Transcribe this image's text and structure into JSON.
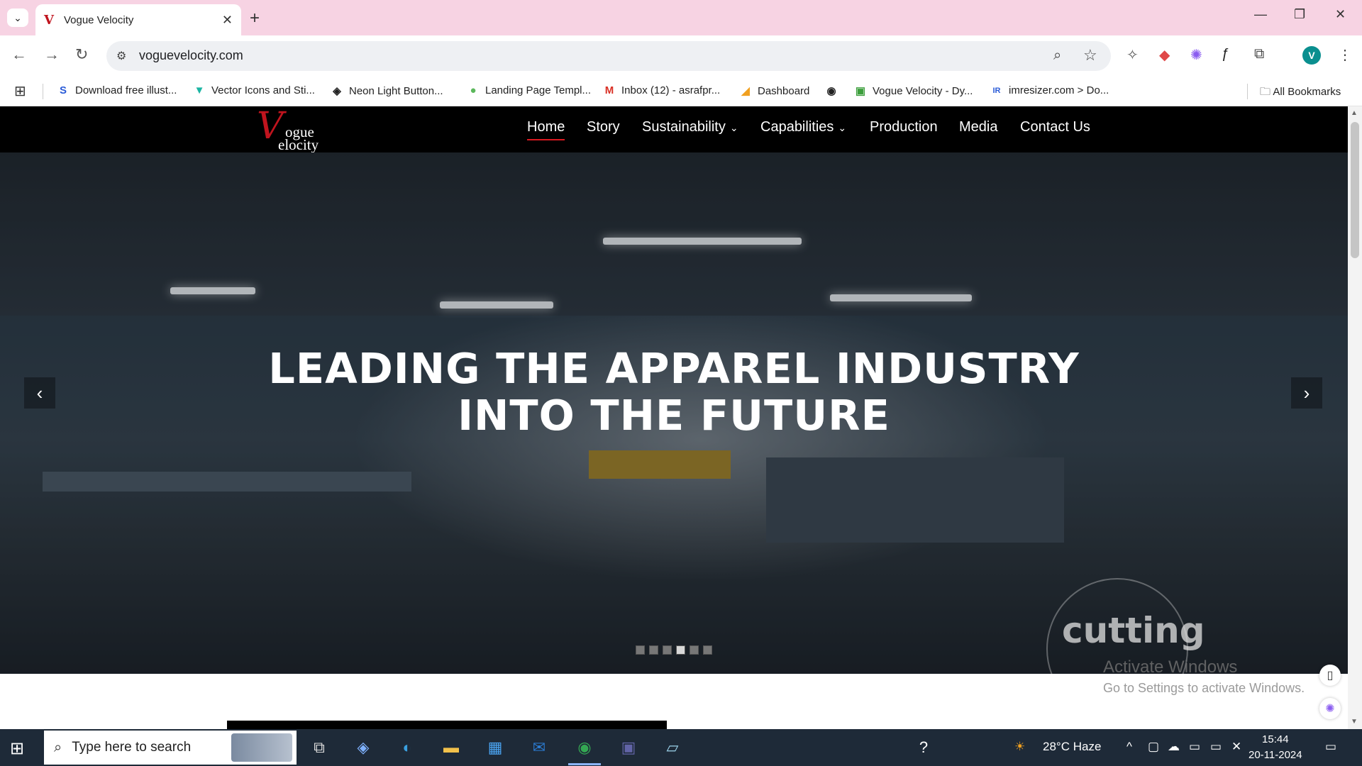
{
  "browser": {
    "tab_title": "Vogue Velocity",
    "tab_favicon": "V",
    "url": "voguevelocity.com",
    "profile_initial": "V",
    "window_controls": [
      "minimize-icon",
      "restore-icon",
      "close-icon"
    ]
  },
  "bookmarks": {
    "items": [
      {
        "label": "Download free illust...",
        "icon": "S"
      },
      {
        "label": "Vector Icons and Sti...",
        "icon": "▼"
      },
      {
        "label": "Neon Light Button...",
        "icon": "◈"
      },
      {
        "label": "Landing Page Templ...",
        "icon": "●"
      },
      {
        "label": "Inbox (12) - asrafpr...",
        "icon": "M"
      },
      {
        "label": "Dashboard",
        "icon": "◢"
      },
      {
        "label": "",
        "icon": "◉"
      },
      {
        "label": "Vogue Velocity - Dy...",
        "icon": "▣"
      },
      {
        "label": "imresizer.com > Do...",
        "icon": "IR"
      }
    ],
    "all_bookmarks": "All Bookmarks"
  },
  "site": {
    "logo": {
      "letter": "V",
      "line1": "ogue",
      "line2": "elocity"
    },
    "nav": [
      {
        "label": "Home",
        "active": true
      },
      {
        "label": "Story",
        "active": false
      },
      {
        "label": "Sustainability",
        "dropdown": true
      },
      {
        "label": "Capabilities",
        "dropdown": true
      },
      {
        "label": "Production",
        "active": false
      },
      {
        "label": "Media",
        "active": false
      },
      {
        "label": "Contact Us",
        "active": false
      }
    ],
    "hero": {
      "line1": "LEADING THE APPAREL INDUSTRY",
      "line2": "INTO THE FUTURE",
      "slides_total": 6,
      "active_slide": 4,
      "background_text": "cutting"
    }
  },
  "watermark": {
    "line1": "Activate Windows",
    "line2": "Go to Settings to activate Windows."
  },
  "taskbar": {
    "search_placeholder": "Type here to search",
    "weather": "28°C  Haze",
    "time": "15:44",
    "date": "20-11-2024"
  }
}
